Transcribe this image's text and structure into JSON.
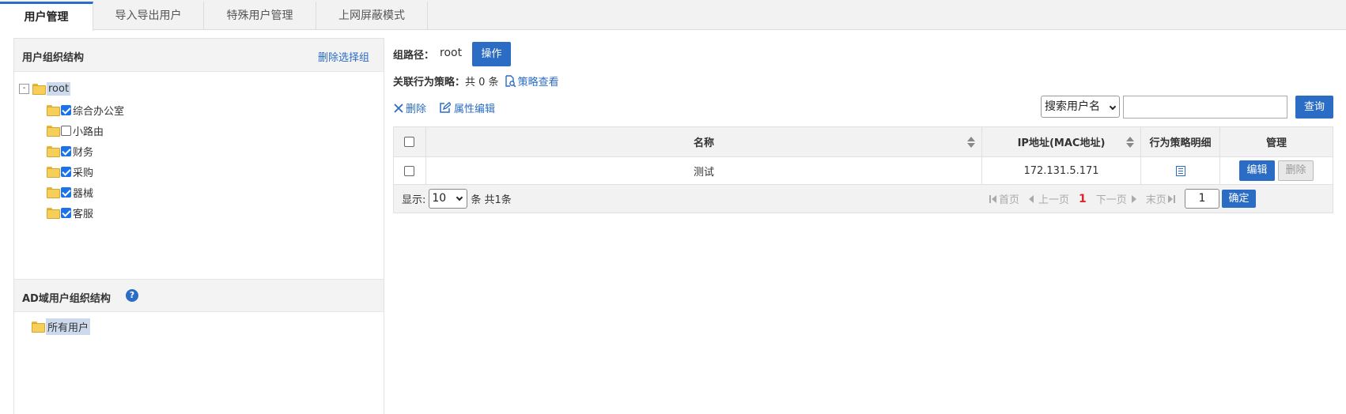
{
  "tabs": [
    {
      "label": "用户管理",
      "active": true
    },
    {
      "label": "导入导出用户",
      "active": false
    },
    {
      "label": "特殊用户管理",
      "active": false
    },
    {
      "label": "上网屏蔽模式",
      "active": false
    }
  ],
  "left_panel": {
    "org_title": "用户组织结构",
    "delete_group": "删除选择组",
    "tree_root": "root",
    "tree_toggle": "-",
    "groups": [
      {
        "label": "综合办公室",
        "checked": true
      },
      {
        "label": "小路由",
        "checked": false
      },
      {
        "label": "财务",
        "checked": true
      },
      {
        "label": "采购",
        "checked": true
      },
      {
        "label": "器械",
        "checked": true
      },
      {
        "label": "客服",
        "checked": true
      }
    ],
    "ad_title": "AD域用户组织结构",
    "ad_help": "?",
    "ad_root": "所有用户"
  },
  "main": {
    "path_label": "组路径：",
    "path_value": "root",
    "operate_button": "操作",
    "policy_label": "关联行为策略：",
    "policy_count": "共 0 条",
    "policy_view": "策略查看",
    "delete_action": "删除",
    "edit_props_action": "属性编辑",
    "search_select": "搜索用户名",
    "search_value": "",
    "query_button": "查询"
  },
  "table": {
    "columns": [
      "名称",
      "IP地址(MAC地址)",
      "行为策略明细",
      "管理"
    ],
    "rows": [
      {
        "name": "测试",
        "ip": "172.131.5.171",
        "edit": "编辑",
        "delete": "删除"
      }
    ]
  },
  "pagination": {
    "show_label": "显示:",
    "page_size": "10",
    "summary": "条 共1条",
    "first": "首页",
    "prev": "上一页",
    "current": "1",
    "next": "下一页",
    "last": "末页",
    "goto_value": "1",
    "confirm": "确定"
  },
  "colors": {
    "accent": "#2b6cc4",
    "current_page": "#d9262e",
    "checkbox": "#1a73e8",
    "folder": "#f6cf59"
  }
}
